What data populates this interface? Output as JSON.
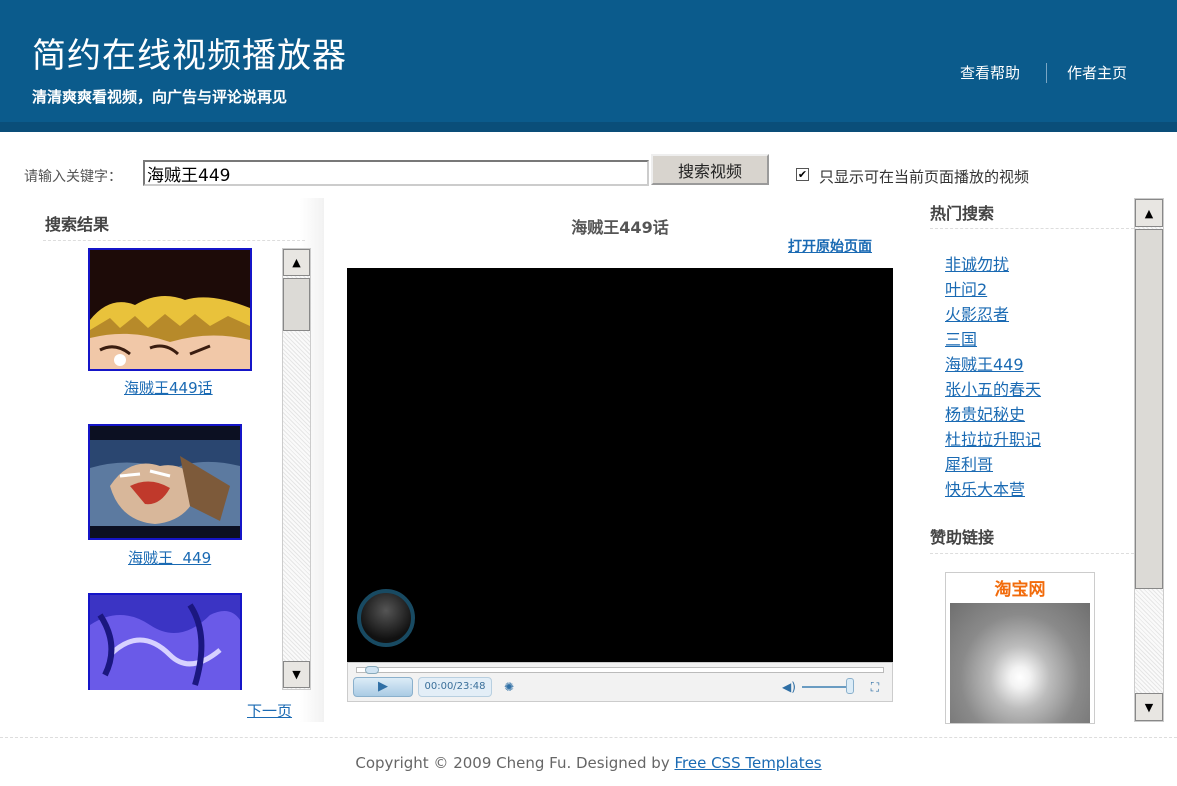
{
  "header": {
    "title": "简约在线视频播放器",
    "subtitle": "清清爽爽看视频，向广告与评论说再见",
    "nav": [
      "查看帮助",
      "作者主页"
    ]
  },
  "search": {
    "label": "请输入关键字：",
    "value": "海贼王449",
    "button": "搜索视频",
    "filter_checked": true,
    "filter_mark": "✔",
    "filter_label": "只显示可在当前页面播放的视频"
  },
  "results": {
    "title": "搜索结果",
    "items": [
      {
        "title": "海贼王449话"
      },
      {
        "title": "海贼王  449"
      },
      {
        "title": ""
      }
    ],
    "next": "下一页"
  },
  "player": {
    "title": "海贼王449话",
    "open_link": "打开原始页面",
    "time": "00:00/23:48",
    "progress": 0,
    "volume": 1.0
  },
  "hot": {
    "title": "热门搜索",
    "items": [
      "非诚勿扰",
      "叶问2",
      "火影忍者",
      "三国",
      "海贼王449",
      "张小五的春天",
      "杨贵妃秘史",
      "杜拉拉升职记",
      "犀利哥",
      "快乐大本营"
    ]
  },
  "sponsor": {
    "title": "赞助链接",
    "brand": "淘宝网"
  },
  "footer": {
    "copyright": "Copyright © 2009 Cheng Fu. Designed by ",
    "link": "Free CSS Templates"
  },
  "colors": {
    "header_bg": "#0b5b8c",
    "link": "#1a6ab3",
    "thumb_border": "#1515c8",
    "brand_orange": "#f26b0b"
  }
}
